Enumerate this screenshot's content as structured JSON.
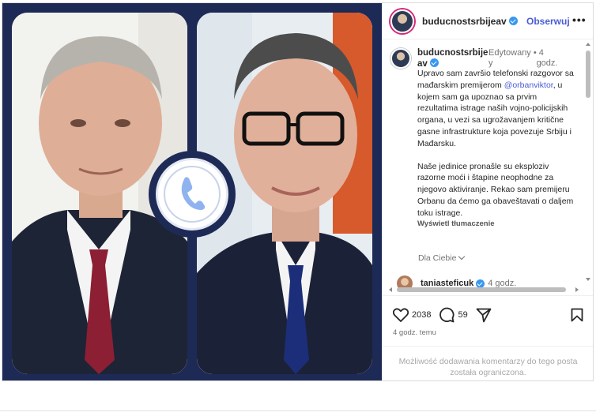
{
  "post": {
    "username": "buducnostsrbijeav",
    "follow_label": "Obserwuj",
    "more_label": "•••",
    "caption": {
      "name_line1": "buducnostsrbije",
      "name_line2": "av",
      "edited": "Edytowany",
      "edited_tail": "y",
      "time_top": "• 4",
      "time_bottom": "godz.",
      "p1_before": "Upravo sam završio telefonski razgovor sa mađarskim premijerom ",
      "mention": "@orbanviktor",
      "p1_after": ", u kojem sam ga upoznao sa prvim rezultatima istrage naših vojno-policijskih organa, u vezi sa ugrožavanjem kritične gasne infrastrukture koja povezuje Srbiju i Mađarsku.",
      "p2": "Naše jedinice pronašle su eksploziv razorne moći i štapine neophodne za njegovo aktiviranje. Rekao sam premijeru Orbanu da ćemo ga obaveštavati o daljem toku istrage.",
      "translate": "Wyświetl tłumaczenie"
    },
    "for_you": "Dla Ciebie",
    "comment_peek": {
      "name": "taniasteficuk",
      "time": "4 godz."
    },
    "likes": "2038",
    "comments": "59",
    "posted_ago": "4 godz. temu",
    "comments_disabled": "Możliwość dodawania komentarzy do tego posta została ograniczona.",
    "colors": {
      "accent": "#4a5dd4",
      "verified": "#3897f0",
      "media_bg": "#1e2a56",
      "phone": "#8fb3ee"
    }
  }
}
